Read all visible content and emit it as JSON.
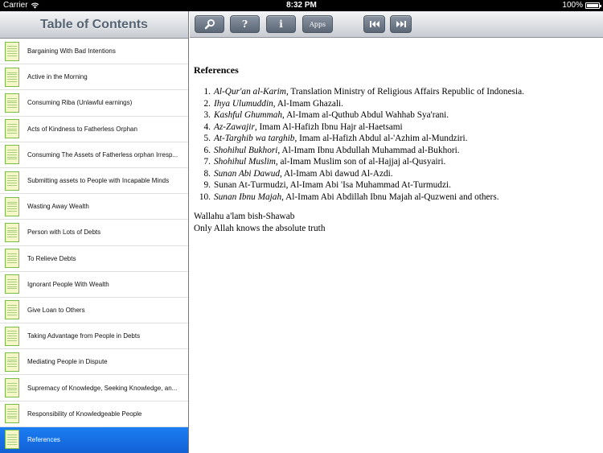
{
  "status_bar": {
    "carrier": "Carrier",
    "time": "8:32 PM",
    "battery_percent": "100%",
    "battery_level": 1.0,
    "wifi_icon": "wifi-icon"
  },
  "sidebar": {
    "title": "Table of Contents",
    "items": [
      {
        "label": "Bargaining With Bad Intentions",
        "selected": false
      },
      {
        "label": "Active in the Morning",
        "selected": false
      },
      {
        "label": "Consuming Riba (Unlawful earnings)",
        "selected": false
      },
      {
        "label": "Acts of Kindness to Fatherless Orphan",
        "selected": false
      },
      {
        "label": "Consuming The Assets of Fatherless orphan Irresp...",
        "selected": false
      },
      {
        "label": "Submitting assets to People with Incapable Minds",
        "selected": false
      },
      {
        "label": "Wasting Away Wealth",
        "selected": false
      },
      {
        "label": "Person with Lots of Debts",
        "selected": false
      },
      {
        "label": "To Relieve Debts",
        "selected": false
      },
      {
        "label": "Ignorant People With Wealth",
        "selected": false
      },
      {
        "label": "Give Loan to Others",
        "selected": false
      },
      {
        "label": "Taking Advantage from People in Debts",
        "selected": false
      },
      {
        "label": "Mediating People in Dispute",
        "selected": false
      },
      {
        "label": "Supremacy of Knowledge, Seeking Knowledge, an...",
        "selected": false
      },
      {
        "label": "Responsibility of Knowledgeable People",
        "selected": false
      },
      {
        "label": "References",
        "selected": true
      }
    ],
    "selected_color": "#1a73e8"
  },
  "toolbar": {
    "search_icon": "search-icon",
    "help_label": "?",
    "info_label": "i",
    "apps_label": "Apps",
    "previous_icon": "skip-back-icon",
    "next_icon": "skip-forward-icon"
  },
  "content": {
    "heading": "References",
    "references": [
      {
        "num": "1.",
        "title": "Al-Qur'an al-Karim",
        "rest": ", Translation Ministry of Religious Affairs Republic of Indonesia."
      },
      {
        "num": "2.",
        "title": "Ihya Ulumuddin",
        "rest": ", Al-Imam Ghazali."
      },
      {
        "num": "3.",
        "title": "Kashful Ghummah",
        "rest": ", Al-Imam al-Quthub Abdul Wahhab Sya'rani."
      },
      {
        "num": "4.",
        "title": "Az-Zawajir",
        "rest": ", Imam Al-Hafizh Ibnu Hajr al-Haetsami"
      },
      {
        "num": "5.",
        "title": "At-Targhib wa targhib",
        "rest": ", Imam al-Hafizh Abdul al-'Azhim al-Mundziri."
      },
      {
        "num": "6.",
        "title": "Shohihul Bukhori",
        "rest": ", Al-Imam Ibnu Abdullah Muhammad al-Bukhori."
      },
      {
        "num": "7.",
        "title": "Shohihul Muslim",
        "rest": ", al-Imam Muslim son of al-Hajjaj al-Qusyairi."
      },
      {
        "num": "8.",
        "title": "Sunan Abi Dawud,",
        "rest": " Al-Imam Abi dawud Al-Azdi."
      },
      {
        "num": "9.",
        "title": "",
        "rest": "Sunan At-Turmudzi, Al-Imam Abi 'Isa Muhammad At-Turmudzi."
      },
      {
        "num": "10.",
        "title": "Sunan Ibnu Majah",
        "rest": ", Al-Imam Abi Abdillah Ibnu Majah al-Quzweni and others."
      }
    ],
    "closing_line_1": "Wallahu a'lam bish-Shawab",
    "closing_line_2": "Only Allah knows the absolute truth"
  }
}
